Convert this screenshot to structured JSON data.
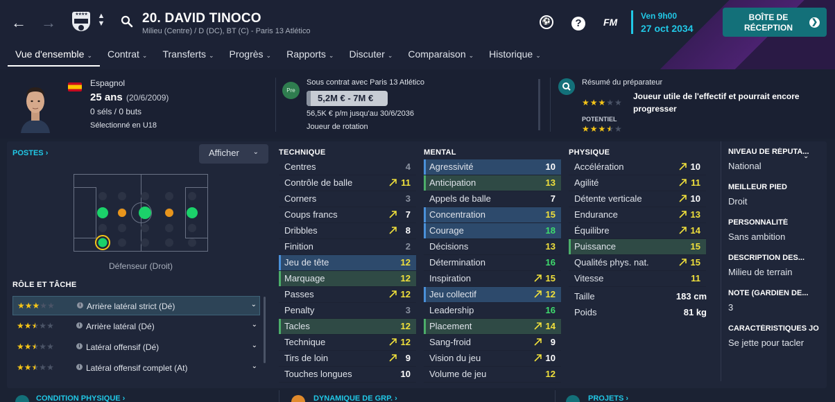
{
  "header": {
    "player_name": "20. DAVID TINOCO",
    "subtitle": "Milieu (Centre) / D (DC), BT (C) - Paris 13 Atlético",
    "date_top": "Ven 9h00",
    "date_main": "27 oct 2034",
    "inbox_label": "BOÎTE DE RÉCEPTION",
    "fm_label": "FM",
    "help_label": "?"
  },
  "tabs": [
    {
      "label": "Vue d'ensemble",
      "active": true
    },
    {
      "label": "Contrat"
    },
    {
      "label": "Transferts"
    },
    {
      "label": "Progrès"
    },
    {
      "label": "Rapports"
    },
    {
      "label": "Discuter"
    },
    {
      "label": "Comparaison"
    },
    {
      "label": "Historique"
    }
  ],
  "profile": {
    "nationality": "Espagnol",
    "age": "25 ans",
    "birth": "(20/6/2009)",
    "caps": "0 séls / 0 buts",
    "selection": "Sélectionné en U18"
  },
  "contract": {
    "badge": "Pre",
    "club": "Sous contrat avec Paris 13 Atlético",
    "value": "5,2M € - 7M €",
    "wage": "56,5K € p/m jusqu'au 30/6/2036",
    "status": "Joueur de rotation"
  },
  "scout": {
    "title": "Résumé du préparateur",
    "summary": "Joueur utile de l'effectif et pourrait encore progresser",
    "ability_stars": 3,
    "potential_label": "POTENTIEL",
    "potential_stars": 3.5
  },
  "positions": {
    "title": "POSTES",
    "show_button": "Afficher",
    "caption": "Défenseur (Droit)"
  },
  "roles": {
    "title": "RÔLE ET TÂCHE",
    "items": [
      {
        "name": "Arrière latéral strict (Dé)",
        "stars": 3
      },
      {
        "name": "Arrière latéral (Dé)",
        "stars": 2.5
      },
      {
        "name": "Latéral offensif (Dé)",
        "stars": 2.5
      },
      {
        "name": "Latéral offensif complet (At)",
        "stars": 2.5
      }
    ]
  },
  "technique": {
    "title": "TECHNIQUE",
    "items": [
      {
        "name": "Centres",
        "value": "4"
      },
      {
        "name": "Contrôle de balle",
        "value": "11"
      },
      {
        "name": "Corners",
        "value": "3"
      },
      {
        "name": "Coups francs",
        "value": "7"
      },
      {
        "name": "Dribbles",
        "value": "8"
      },
      {
        "name": "Finition",
        "value": "2"
      },
      {
        "name": "Jeu de tête",
        "value": "12"
      },
      {
        "name": "Marquage",
        "value": "12"
      },
      {
        "name": "Passes",
        "value": "12"
      },
      {
        "name": "Penalty",
        "value": "3"
      },
      {
        "name": "Tacles",
        "value": "12"
      },
      {
        "name": "Technique",
        "value": "12"
      },
      {
        "name": "Tirs de loin",
        "value": "9"
      },
      {
        "name": "Touches longues",
        "value": "10"
      }
    ]
  },
  "mental": {
    "title": "MENTAL",
    "items": [
      {
        "name": "Agressivité",
        "value": "10"
      },
      {
        "name": "Anticipation",
        "value": "13"
      },
      {
        "name": "Appels de balle",
        "value": "7"
      },
      {
        "name": "Concentration",
        "value": "15"
      },
      {
        "name": "Courage",
        "value": "18"
      },
      {
        "name": "Décisions",
        "value": "13"
      },
      {
        "name": "Détermination",
        "value": "16"
      },
      {
        "name": "Inspiration",
        "value": "15"
      },
      {
        "name": "Jeu collectif",
        "value": "12"
      },
      {
        "name": "Leadership",
        "value": "16"
      },
      {
        "name": "Placement",
        "value": "14"
      },
      {
        "name": "Sang-froid",
        "value": "9"
      },
      {
        "name": "Vision du jeu",
        "value": "10"
      },
      {
        "name": "Volume de jeu",
        "value": "12"
      }
    ]
  },
  "physique": {
    "title": "PHYSIQUE",
    "items": [
      {
        "name": "Accélération",
        "value": "10"
      },
      {
        "name": "Agilité",
        "value": "11"
      },
      {
        "name": "Détente verticale",
        "value": "10"
      },
      {
        "name": "Endurance",
        "value": "13"
      },
      {
        "name": "Équilibre",
        "value": "14"
      },
      {
        "name": "Puissance",
        "value": "15"
      },
      {
        "name": "Qualités phys. nat.",
        "value": "15"
      },
      {
        "name": "Vitesse",
        "value": "11"
      }
    ],
    "height_label": "Taille",
    "height": "183 cm",
    "weight_label": "Poids",
    "weight": "81 kg"
  },
  "info": [
    {
      "label": "NIVEAU DE RÉPUTA...",
      "value": "National"
    },
    {
      "label": "MEILLEUR PIED",
      "value": "Droit"
    },
    {
      "label": "PERSONNALITÉ",
      "value": "Sans ambition"
    },
    {
      "label": "DESCRIPTION DES...",
      "value": "Milieu de terrain"
    },
    {
      "label": "NOTE (GARDIEN DE...",
      "value": "3"
    },
    {
      "label": "CARACTÉRISTIQUES JO",
      "value": "Se jette pour tacler"
    }
  ],
  "bottom": {
    "condition": "CONDITION PHYSIQUE",
    "dynamics": "DYNAMIQUE DE GRP.",
    "projects": "PROJETS"
  },
  "colors": {
    "accent": "#21c8e6",
    "inbox": "#137079",
    "highlight_value": "#f0e03c",
    "good_value": "#3fdc6e"
  }
}
